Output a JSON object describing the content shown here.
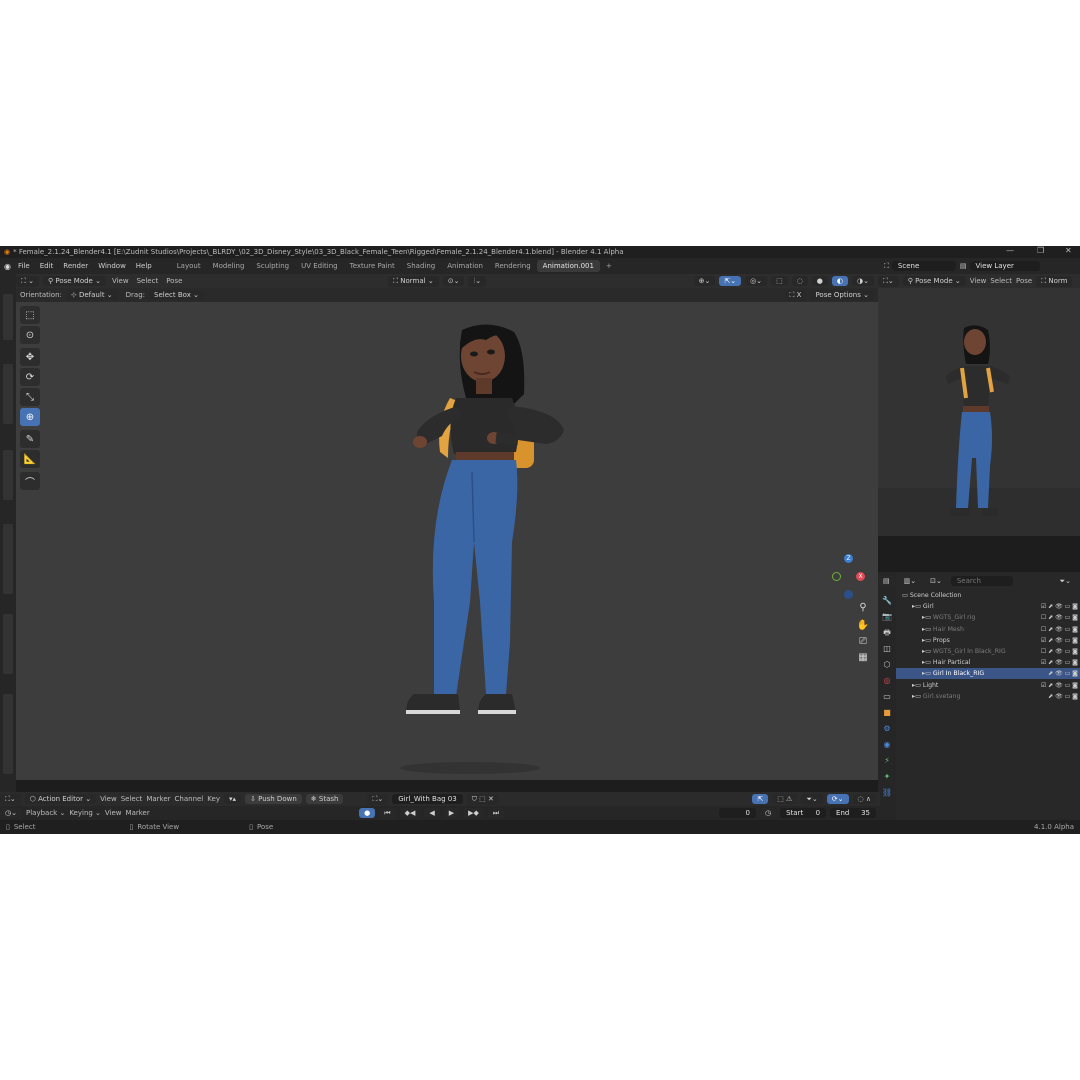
{
  "window": {
    "title": "* Female_2.1.24_Blender4.1 [E:\\Zudnit Studios\\Projects\\_BLRDY_\\02_3D_Disney_Style\\03_3D_Black_Female_Teen\\Rigged\\Female_2.1.24_Blender4.1.blend] - Blender 4.1 Alpha",
    "minimize": "—",
    "maximize": "❐",
    "close": "✕"
  },
  "menu": [
    "File",
    "Edit",
    "Render",
    "Window",
    "Help"
  ],
  "workspaces": [
    "Layout",
    "Modeling",
    "Sculpting",
    "UV Editing",
    "Texture Paint",
    "Shading",
    "Animation",
    "Rendering",
    "Animation.001"
  ],
  "workspace_add": "+",
  "viewport_header": {
    "mode": "Pose Mode",
    "menus": [
      "View",
      "Select",
      "Pose"
    ],
    "transform_orientation": "Normal"
  },
  "tool_settings": {
    "orientation_label": "Orientation:",
    "orientation_value": "Default",
    "drag_label": "Drag:",
    "drag_value": "Select Box",
    "pose_options": "Pose Options"
  },
  "gizmo": {
    "z": "Z",
    "x": "X",
    "y": "Y"
  },
  "scene_header": {
    "scene": "Scene",
    "view_layer": "View Layer"
  },
  "render_header": {
    "mode": "Pose Mode",
    "menus": [
      "View",
      "Select",
      "Pose"
    ],
    "extra": "Norm"
  },
  "outliner": {
    "search_placeholder": "Search",
    "rows": [
      {
        "label": "Scene Collection",
        "level": 0,
        "style": "normal",
        "icons": ""
      },
      {
        "label": "Girl",
        "level": 1,
        "style": "normal",
        "icons": "☑ ⬈ 👁 ▭ ◙"
      },
      {
        "label": "WGTS_Girl rig",
        "level": 2,
        "style": "dim",
        "icons": "☐ ⬈ 👁 ▭ ◙"
      },
      {
        "label": "Hair Mesh",
        "level": 2,
        "style": "dim",
        "icons": "☐ ⬈ 👁 ▭ ◙"
      },
      {
        "label": "Props",
        "level": 2,
        "style": "normal",
        "icons": "☑ ⬈ 👁 ▭ ◙"
      },
      {
        "label": "WGTS_Girl In Black_RIG",
        "level": 2,
        "style": "dim",
        "icons": "☐ ⬈ 👁 ▭ ◙"
      },
      {
        "label": "Hair Partical",
        "level": 2,
        "style": "normal",
        "icons": "☑ ⬈ 👁 ▭ ◙"
      },
      {
        "label": "Girl In Black_RIG",
        "level": 2,
        "style": "sel",
        "icons": "⬈ 👁 ▭ ◙"
      },
      {
        "label": "Light",
        "level": 1,
        "style": "normal",
        "icons": "☑ ⬈ 👁 ▭ ◙"
      },
      {
        "label": "Girl.svetang",
        "level": 1,
        "style": "dim",
        "icons": "⬈ 👁 ▭ ◙"
      }
    ]
  },
  "action_editor": {
    "mode": "Action Editor",
    "menus": [
      "View",
      "Select",
      "Marker",
      "Channel",
      "Key"
    ],
    "push_down": "Push Down",
    "stash": "Stash",
    "action": "Girl_With Bag 03"
  },
  "timeline": {
    "menus": [
      "Playback",
      "Keying",
      "View",
      "Marker"
    ],
    "current_frame": "0",
    "start_label": "Start",
    "start": "0",
    "end_label": "End",
    "end": "35"
  },
  "statusbar": {
    "select": "Select",
    "rotate": "Rotate View",
    "pose": "Pose",
    "version": "4.1.0 Alpha"
  },
  "colors": {
    "accent": "#4772b3",
    "selected_row": "#3b5586",
    "viewport_bg": "#3d3d3d",
    "x_axis": "#e04a55",
    "y_axis": "#6fb13c",
    "z_axis": "#3d7fd4"
  }
}
